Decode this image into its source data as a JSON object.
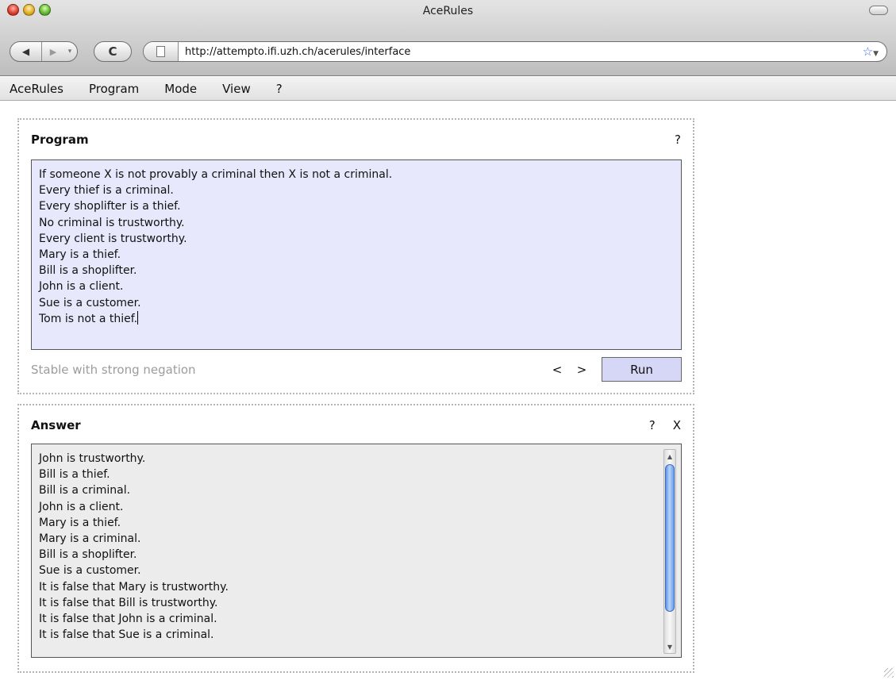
{
  "window": {
    "title": "AceRules"
  },
  "browser": {
    "url": "http://attempto.ifi.uzh.ch/acerules/interface",
    "icons": {
      "back": "back-arrow-icon",
      "forward": "forward-arrow-icon",
      "reload": "reload-icon",
      "page": "page-icon",
      "bookmark": "star-icon"
    }
  },
  "menu": {
    "items": [
      {
        "label": "AceRules"
      },
      {
        "label": "Program"
      },
      {
        "label": "Mode"
      },
      {
        "label": "View"
      },
      {
        "label": "?"
      }
    ]
  },
  "program_panel": {
    "title": "Program",
    "help": "?",
    "lines": [
      "If someone X is not provably a criminal then X is not a criminal.",
      "Every thief is a criminal.",
      "Every shoplifter is a thief.",
      "No criminal is trustworthy.",
      "Every client is trustworthy.",
      "Mary is a thief.",
      "Bill is a shoplifter.",
      "John is a client.",
      "Sue is a customer.",
      "Tom is not a thief."
    ],
    "mode": "Stable with strong negation",
    "prev": "<",
    "next": ">",
    "run": "Run",
    "colors": {
      "textbox_bg": "#e8e8fc",
      "run_bg": "#d6d6f7",
      "mode_text": "#9c9c9c"
    }
  },
  "answer_panel": {
    "title": "Answer",
    "help": "?",
    "close": "X",
    "lines": [
      "John is trustworthy.",
      "Bill is a thief.",
      "Bill is a criminal.",
      "John is a client.",
      "Mary is a thief.",
      "Mary is a criminal.",
      "Bill is a shoplifter.",
      "Sue is a customer.",
      "It is false that Mary is trustworthy.",
      "It is false that Bill is trustworthy.",
      "It is false that John is a criminal.",
      "It is false that Sue is a criminal."
    ],
    "colors": {
      "answer_bg": "#ececec"
    }
  }
}
